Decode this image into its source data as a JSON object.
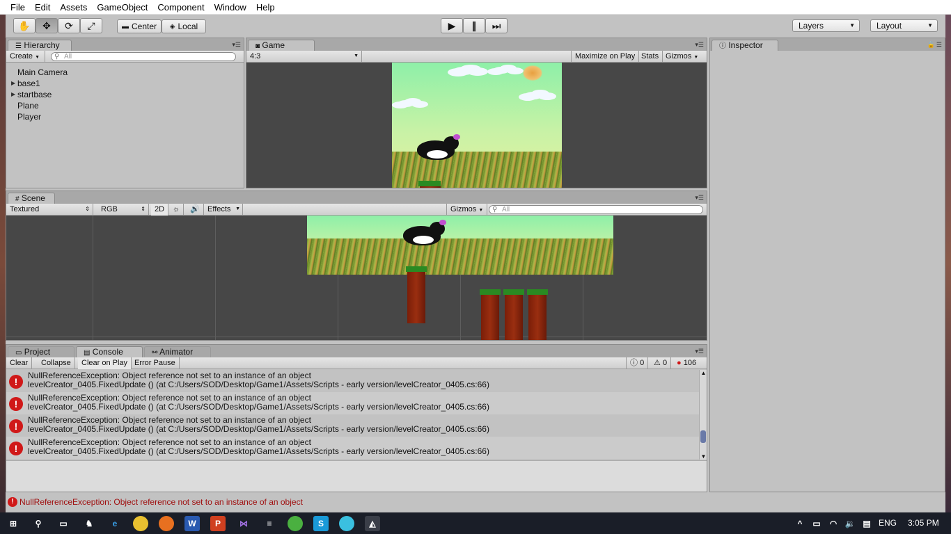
{
  "menu": [
    "File",
    "Edit",
    "Assets",
    "GameObject",
    "Component",
    "Window",
    "Help"
  ],
  "toolbar": {
    "pivot_label": "Center",
    "space_label": "Local",
    "layers_label": "Layers",
    "layout_label": "Layout"
  },
  "hierarchy": {
    "tab": "Hierarchy",
    "create_label": "Create",
    "search_placeholder": "All",
    "items": [
      "Main Camera",
      "base1",
      "startbase",
      "Plane",
      "Player"
    ]
  },
  "game": {
    "tab": "Game",
    "aspect": "4:3",
    "maximize": "Maximize on Play",
    "stats": "Stats",
    "gizmos": "Gizmos"
  },
  "inspector": {
    "tab": "Inspector"
  },
  "scene": {
    "tab": "Scene",
    "render_mode": "Textured",
    "color_mode": "RGB",
    "mode_2d": "2D",
    "effects": "Effects",
    "gizmos": "Gizmos",
    "search_placeholder": "All"
  },
  "bottom_tabs": {
    "project": "Project",
    "console": "Console",
    "animator": "Animator"
  },
  "console": {
    "clear": "Clear",
    "collapse": "Collapse",
    "clear_on_play": "Clear on Play",
    "error_pause": "Error Pause",
    "info_count": "0",
    "warning_count": "0",
    "error_count": "106",
    "logs": [
      {
        "line1": "NullReferenceException: Object reference not set to an instance of an object",
        "line2": "levelCreator_0405.FixedUpdate () (at C:/Users/SOD/Desktop/Game1/Assets/Scripts - early version/levelCreator_0405.cs:66)"
      },
      {
        "line1": "NullReferenceException: Object reference not set to an instance of an object",
        "line2": "levelCreator_0405.FixedUpdate () (at C:/Users/SOD/Desktop/Game1/Assets/Scripts - early version/levelCreator_0405.cs:66)"
      },
      {
        "line1": "NullReferenceException: Object reference not set to an instance of an object",
        "line2": "levelCreator_0405.FixedUpdate () (at C:/Users/SOD/Desktop/Game1/Assets/Scripts - early version/levelCreator_0405.cs:66)"
      },
      {
        "line1": "NullReferenceException: Object reference not set to an instance of an object",
        "line2": "levelCreator_0405.FixedUpdate () (at C:/Users/SOD/Desktop/Game1/Assets/Scripts - early version/levelCreator_0405.cs:66)"
      }
    ]
  },
  "status_bar": {
    "message": "NullReferenceException: Object reference not set to an instance of an object"
  },
  "taskbar": {
    "language": "ENG",
    "time": "3:05 PM"
  },
  "colors": {
    "error_red": "#d01818",
    "unity_panel": "#c2c2c2",
    "scene_bg": "#474747",
    "taskbar": "#1a1e28"
  }
}
